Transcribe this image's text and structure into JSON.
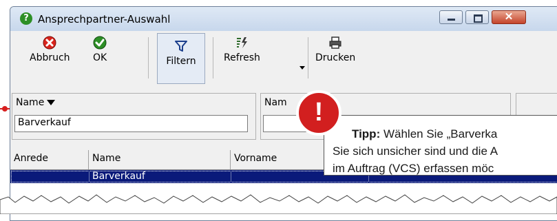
{
  "window": {
    "title": "Ansprechpartner-Auswahl",
    "close_glyph": "✕"
  },
  "toolbar": {
    "cancel_label": "Abbruch",
    "ok_label": "OK",
    "filter_label": "Filtern",
    "refresh_label": "Refresh",
    "print_label": "Drucken"
  },
  "filters": [
    {
      "label": "Name",
      "value": "Barverkauf"
    },
    {
      "label": "Nam",
      "value": ""
    }
  ],
  "grid": {
    "columns": [
      "Anrede",
      "Name",
      "Vorname"
    ],
    "rows": [
      {
        "anrede": "",
        "name": "Barverkauf",
        "vorname": ""
      }
    ]
  },
  "callout": {
    "badge": "!",
    "tip_prefix": "Tipp:",
    "line1": "Wählen Sie „Barverka",
    "line2": "Sie sich unsicher sind und die A",
    "line3": "im Auftrag (VCS) erfassen möc"
  },
  "colors": {
    "selection": "#0a1a7a",
    "accent_red": "#d21f1f",
    "cancel_red": "#d9241c",
    "ok_green": "#2d8f26"
  },
  "icons": {
    "title": "help-question-icon",
    "cancel": "cancel-x-icon",
    "ok": "ok-check-icon",
    "filter": "funnel-icon",
    "refresh": "refresh-lightning-icon",
    "print": "printer-icon"
  }
}
